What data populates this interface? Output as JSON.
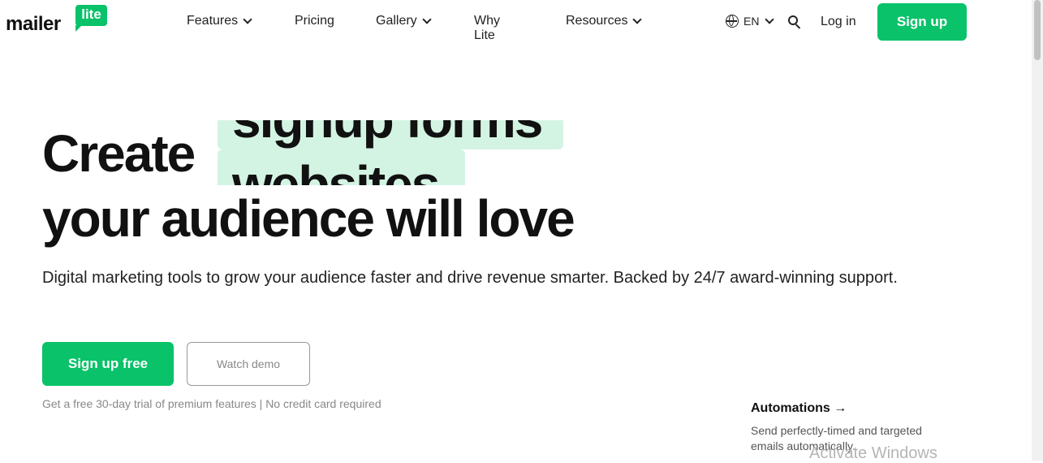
{
  "logo": {
    "wordmark": "mailer",
    "badge": "lite"
  },
  "nav": {
    "items": [
      {
        "label": "Features",
        "has_dropdown": true
      },
      {
        "label": "Pricing",
        "has_dropdown": false
      },
      {
        "label": "Gallery",
        "has_dropdown": true
      },
      {
        "label": "Why Lite",
        "has_dropdown": false
      },
      {
        "label": "Resources",
        "has_dropdown": true
      }
    ],
    "language": "EN",
    "login": "Log in",
    "signup": "Sign up"
  },
  "hero": {
    "lead": "Create",
    "rotating_words": [
      "signup forms",
      "websites"
    ],
    "line2": "your audience will love",
    "subtitle": "Digital marketing tools to grow your audience faster and drive revenue smarter. Backed by 24/7 award-winning support.",
    "cta_primary": "Sign up free",
    "cta_secondary": "Watch demo",
    "trial_note": "Get a free 30-day trial of premium features | No credit card required"
  },
  "feature_card": {
    "title": "Automations →",
    "description": "Send perfectly-timed and targeted emails automatically."
  },
  "overlay": {
    "watermark": "Activate Windows"
  },
  "colors": {
    "brand_green": "#09c269",
    "highlight": "#d4f4e3"
  },
  "icons": [
    "globe-icon",
    "search-icon",
    "chevron-down-icon",
    "arrow-right-icon"
  ]
}
